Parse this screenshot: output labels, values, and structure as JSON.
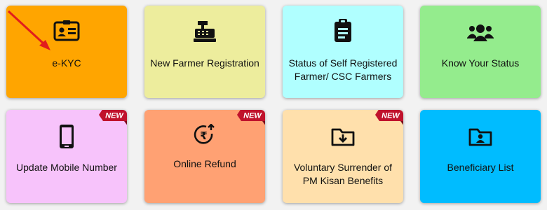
{
  "tiles": [
    {
      "id": "ekyc",
      "label_lines": [
        "e-KYC"
      ],
      "bg": "#ffa500",
      "icon": "id-card-icon",
      "new": false
    },
    {
      "id": "new-farmer",
      "label_lines": [
        "New Farmer Registration"
      ],
      "bg": "#eded9d",
      "icon": "cash-register-icon",
      "new": false
    },
    {
      "id": "self-registered-status",
      "label_lines": [
        "Status of Self Registered",
        "Farmer/ CSC Farmers"
      ],
      "bg": "#b0ffff",
      "icon": "clipboard-list-icon",
      "new": false
    },
    {
      "id": "know-status",
      "label_lines": [
        "Know Your Status"
      ],
      "bg": "#94ec8d",
      "icon": "users-group-icon",
      "new": false
    },
    {
      "id": "update-mobile",
      "label_lines": [
        "Update Mobile Number"
      ],
      "bg": "#f7c3fb",
      "icon": "mobile-phone-icon",
      "new": true
    },
    {
      "id": "online-refund",
      "label_lines": [
        "Online Refund"
      ],
      "bg": "#ffa173",
      "icon": "rupee-refund-icon",
      "new": true
    },
    {
      "id": "voluntary-surrender",
      "label_lines": [
        "Voluntary Surrender of",
        "PM Kisan Benefits"
      ],
      "bg": "#ffe0ac",
      "icon": "folder-download-icon",
      "new": true
    },
    {
      "id": "beneficiary-list",
      "label_lines": [
        "Beneficiary List"
      ],
      "bg": "#00bcff",
      "icon": "folder-user-icon",
      "new": false
    }
  ],
  "new_badge_text": "NEW",
  "colors": {
    "ribbon": "#c0122c",
    "arrow": "#e11d1d"
  }
}
